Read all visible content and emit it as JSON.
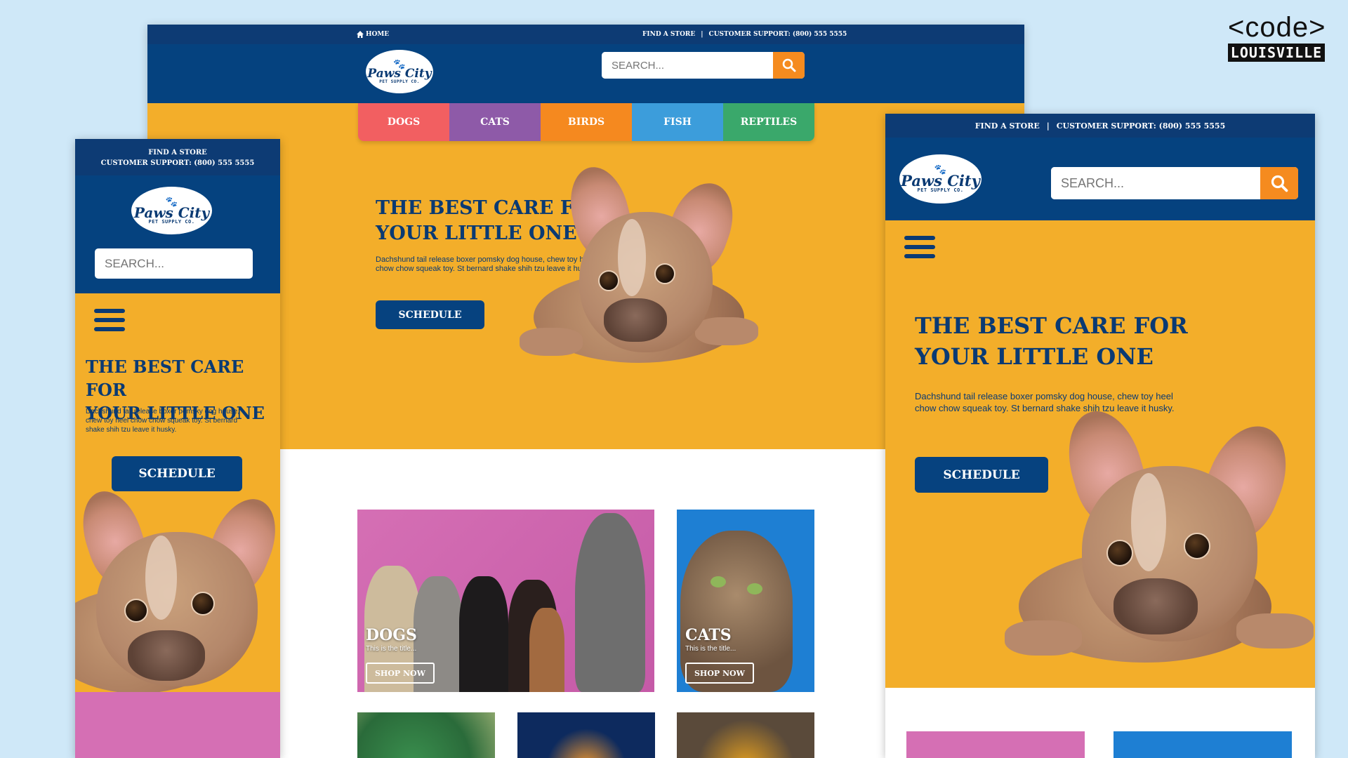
{
  "brand": {
    "code": "<code>",
    "city": "LOUISVILLE"
  },
  "logo": {
    "name": "Paws City",
    "sub": "PET SUPPLY CO."
  },
  "topbar": {
    "home": "HOME",
    "find_store": "FIND A STORE",
    "separator": "|",
    "support": "CUSTOMER SUPPORT: (800) 555 5555"
  },
  "search": {
    "placeholder": "SEARCH..."
  },
  "nav": [
    {
      "label": "DOGS",
      "color": "#f25f61"
    },
    {
      "label": "CATS",
      "color": "#8e5aa8"
    },
    {
      "label": "BIRDS",
      "color": "#f5891f"
    },
    {
      "label": "FISH",
      "color": "#3c9ddb"
    },
    {
      "label": "REPTILES",
      "color": "#3aa86b"
    }
  ],
  "hero": {
    "title_line1": "THE BEST CARE FOR",
    "title_line2": "YOUR LITTLE ONE",
    "body": "Dachshund tail release boxer pomsky dog house, chew toy heel chow chow squeak toy. St bernard shake shih tzu leave it husky.",
    "button": "SCHEDULE"
  },
  "cards": [
    {
      "title": "DOGS",
      "subtitle": "This is the title...",
      "button": "SHOP NOW"
    },
    {
      "title": "CATS",
      "subtitle": "This is the title...",
      "button": "SHOP NOW"
    }
  ],
  "colors": {
    "navy": "#05427f",
    "orange": "#f58b1f",
    "yellow": "#f3ae2a"
  }
}
